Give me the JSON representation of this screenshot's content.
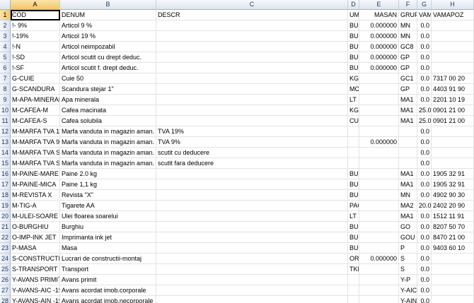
{
  "columns": [
    "A",
    "B",
    "C",
    "D",
    "E",
    "F",
    "G",
    "H"
  ],
  "rows": [
    {
      "n": "1",
      "A": "COD",
      "B": "DENUM",
      "C": "DESCR",
      "D": "UM",
      "E": "MASAN",
      "F": "GRUPA",
      "G": "VAMA",
      "H": "VAMAPOZ"
    },
    {
      "n": "2",
      "A": "!- 9%",
      "B": "Articol  9 %",
      "C": "",
      "D": "BUC",
      "E": "0.000000",
      "F": "MN",
      "G": "0.0",
      "H": ""
    },
    {
      "n": "3",
      "A": "!-19%",
      "B": "Articol 19 %",
      "C": "",
      "D": "BUC",
      "E": "0.000000",
      "F": "MN",
      "G": "0.0",
      "H": ""
    },
    {
      "n": "4",
      "A": "!-N",
      "B": "Articol neimpozabil",
      "C": "",
      "D": "BUC",
      "E": "0.000000",
      "F": "GC8",
      "G": "0.0",
      "H": ""
    },
    {
      "n": "5",
      "A": "!-SD",
      "B": "Articol scutit cu drept deduc.",
      "C": "",
      "D": "BUC",
      "E": "0.000000",
      "F": "GP",
      "G": "0.0",
      "H": ""
    },
    {
      "n": "6",
      "A": "!-SF",
      "B": "Articol scutit f. drept deduc.",
      "C": "",
      "D": "BUC",
      "E": "0.000000",
      "F": "GP",
      "G": "0.0",
      "H": ""
    },
    {
      "n": "7",
      "A": "G-CUIE",
      "B": "Cuie 50",
      "C": "",
      "D": "KG",
      "E": "",
      "F": "GC1",
      "G": "0.0",
      "H": "7317 00 20"
    },
    {
      "n": "8",
      "A": "G-SCANDURA",
      "B": "Scandura stejar 1\"",
      "C": "",
      "D": "MC",
      "E": "",
      "F": "GP",
      "G": "0.0",
      "H": "4403 91 90"
    },
    {
      "n": "9",
      "A": "M-APA-MINERALA",
      "B": "Apa minerala",
      "C": "",
      "D": "LT",
      "E": "",
      "F": "MA1",
      "G": "0.0",
      "H": "2201 10 19"
    },
    {
      "n": "10",
      "A": "M-CAFEA-M",
      "B": "Cafea macinata",
      "C": "",
      "D": "KG",
      "E": "",
      "F": "MA1",
      "G": "25.0",
      "H": "0901 21 00"
    },
    {
      "n": "11",
      "A": "M-CAFEA-S",
      "B": "Cafea solubila",
      "C": "",
      "D": "CUT",
      "E": "",
      "F": "MA1",
      "G": "25.0",
      "H": "0901 21 00"
    },
    {
      "n": "12",
      "A": "M-MARFA TVA 19%",
      "B": "Marfa vanduta in magazin aman.",
      "C": "TVA 19%",
      "D": "",
      "E": "",
      "F": "",
      "G": "0.0",
      "H": ""
    },
    {
      "n": "13",
      "A": "M-MARFA TVA 9%",
      "B": "Marfa vanduta in magazin aman.",
      "C": "TVA  9%",
      "D": "",
      "E": "0.000000",
      "F": "",
      "G": "0.0",
      "H": ""
    },
    {
      "n": "14",
      "A": "M-MARFA TVA SD",
      "B": "Marfa vanduta in magazin aman.",
      "C": "scutit cu deducere",
      "D": "",
      "E": "",
      "F": "",
      "G": "0.0",
      "H": ""
    },
    {
      "n": "15",
      "A": "M-MARFA TVA SF",
      "B": "Marfa vanduta in magazin aman.",
      "C": "scutit fara deducere",
      "D": "",
      "E": "",
      "F": "",
      "G": "0.0",
      "H": ""
    },
    {
      "n": "16",
      "A": "M-PAINE-MARE",
      "B": "Paine 2.0 kg",
      "C": "",
      "D": "BUC",
      "E": "",
      "F": "MA1",
      "G": "0.0",
      "H": "1905 32 91"
    },
    {
      "n": "17",
      "A": "M-PAINE-MICA",
      "B": "Paine 1,1 kg",
      "C": "",
      "D": "BUC",
      "E": "",
      "F": "MA1",
      "G": "0.0",
      "H": "1905 32 91"
    },
    {
      "n": "18",
      "A": "M-REVISTA X",
      "B": "Revista \"X\"",
      "C": "",
      "D": "BUC",
      "E": "",
      "F": "MN",
      "G": "0.0",
      "H": "4902 90 30"
    },
    {
      "n": "19",
      "A": "M-TIG-A",
      "B": "Tigarete AA",
      "C": "",
      "D": "PAC",
      "E": "",
      "F": "MA2",
      "G": "20.0",
      "H": "2402 20 90"
    },
    {
      "n": "20",
      "A": "M-ULEI-SOARE",
      "B": "Ulei floarea soarelui",
      "C": "",
      "D": "LT",
      "E": "",
      "F": "MA1",
      "G": "0.0",
      "H": "1512 11 91"
    },
    {
      "n": "21",
      "A": "O-BURGHIU",
      "B": "Burghiu",
      "C": "",
      "D": "BUC",
      "E": "",
      "F": "GO",
      "G": "0.0",
      "H": "8207 50 70"
    },
    {
      "n": "22",
      "A": "O-IMP-INK JET",
      "B": "Imprimanta ink jet",
      "C": "",
      "D": "BUC",
      "E": "",
      "F": "GOU",
      "G": "0.0",
      "H": "8470 21 00"
    },
    {
      "n": "23",
      "A": "P-MASA",
      "B": "Masa",
      "C": "",
      "D": "BUC",
      "E": "",
      "F": "P",
      "G": "0.0",
      "H": "9403 60 10"
    },
    {
      "n": "24",
      "A": "S-CONSTRUCTII",
      "B": "Lucrari de constructii-montaj",
      "C": "",
      "D": "ORE",
      "E": "0.000000",
      "F": "S",
      "G": "0.0",
      "H": ""
    },
    {
      "n": "25",
      "A": "S-TRANSPORT",
      "B": "Transport",
      "C": "",
      "D": "TKM",
      "E": "",
      "F": "S",
      "G": "0.0",
      "H": ""
    },
    {
      "n": "26",
      "A": "Y-AVANS PRIMIT",
      "B": "Avans primit",
      "C": "",
      "D": "",
      "E": "",
      "F": "Y-P",
      "G": "0.0",
      "H": ""
    },
    {
      "n": "27",
      "A": "Y-AVANS-AIC -19",
      "B": "Avans acordat imob.corporale",
      "C": "",
      "D": "",
      "E": "",
      "F": "Y-AIC",
      "G": "0.0",
      "H": ""
    },
    {
      "n": "28",
      "A": "Y-AVANS-AIN -19",
      "B": "Avans acordat imob.necorporale",
      "C": "",
      "D": "",
      "E": "",
      "F": "Y-AIN",
      "G": "0.0",
      "H": ""
    }
  ]
}
